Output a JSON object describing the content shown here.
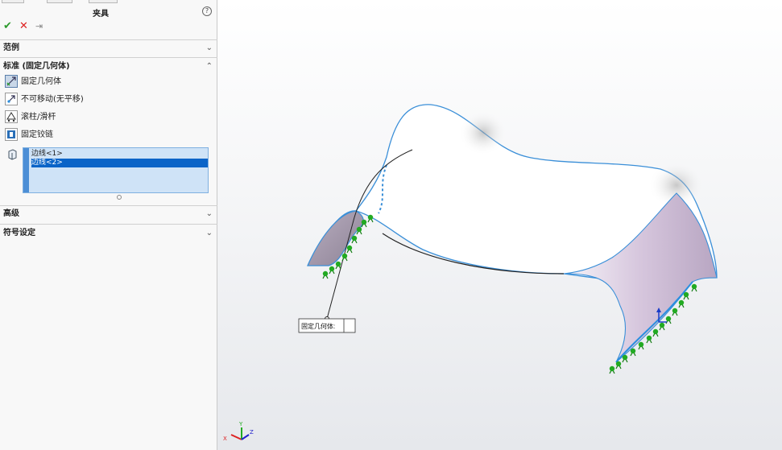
{
  "panel": {
    "title": "夹具",
    "help_icon": "help-icon",
    "confirm_icon": "✔",
    "cancel_icon": "✕",
    "pin_icon": "⇥",
    "sections": {
      "example": "范例",
      "standard": "标准 (固定几何体)",
      "advanced": "高级",
      "symbol": "符号设定"
    },
    "options": [
      {
        "label": "固定几何体",
        "icon": "fixed-geometry-icon"
      },
      {
        "label": "不可移动(无平移)",
        "icon": "immovable-icon"
      },
      {
        "label": "滚柱/滑杆",
        "icon": "roller-slider-icon"
      },
      {
        "label": "固定铰链",
        "icon": "fixed-hinge-icon"
      }
    ],
    "selection_list": [
      "边线<1>",
      "边线<2>"
    ]
  },
  "viewport": {
    "callout_label": "固定几何体:",
    "axis_labels": {
      "x": "X",
      "y": "Y",
      "z": "Z"
    }
  },
  "colors": {
    "selection_blue": "#0a64c8",
    "fixture_green": "#22aa22",
    "edge_blue": "#3a8fd8"
  }
}
